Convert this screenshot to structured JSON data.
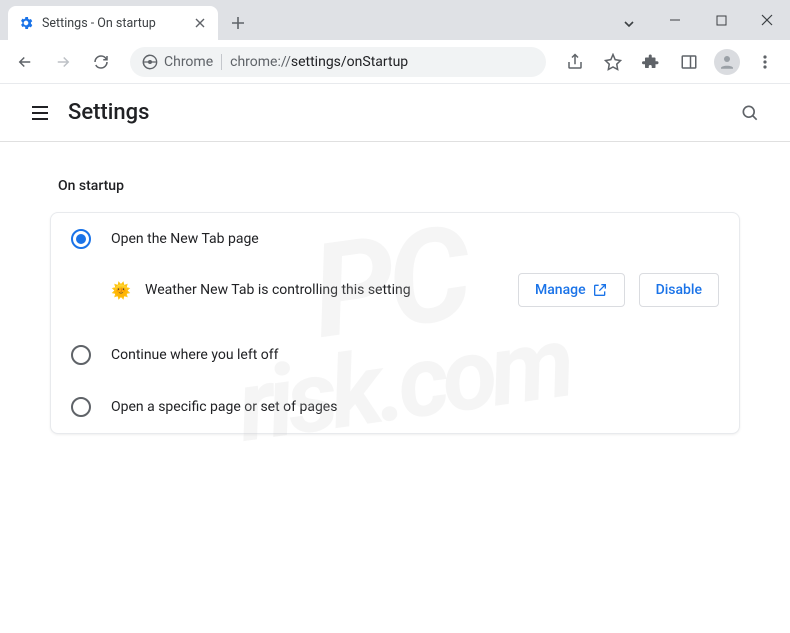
{
  "tab": {
    "title": "Settings - On startup"
  },
  "omnibox": {
    "secure_label": "Chrome",
    "url_prefix": "chrome://",
    "url_path": "settings/onStartup"
  },
  "settings_header": {
    "title": "Settings"
  },
  "section": {
    "title": "On startup"
  },
  "options": {
    "opt1": "Open the New Tab page",
    "opt2": "Continue where you left off",
    "opt3": "Open a specific page or set of pages"
  },
  "extension_notice": {
    "text": "Weather New Tab is controlling this setting",
    "manage_label": "Manage",
    "disable_label": "Disable"
  },
  "watermark": {
    "line1": "PC",
    "line2": "risk.com"
  }
}
